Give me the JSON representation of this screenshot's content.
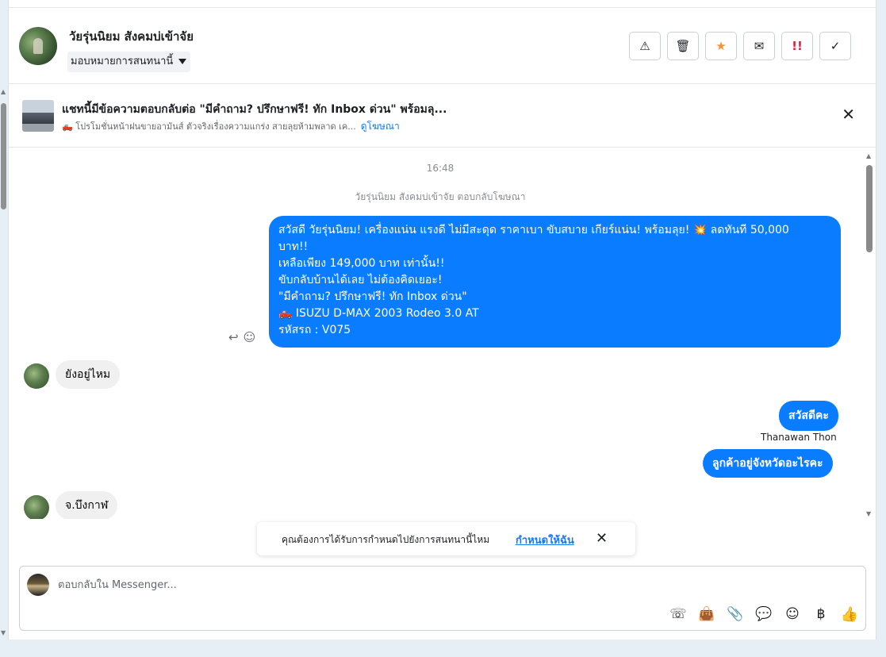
{
  "header": {
    "contact_name": "วัยรุ่นนิยม สังคมบ่เข้าจัย",
    "assign_label": "มอบหมายการสนทนานี้",
    "actions": {
      "spam": "⚠",
      "delete": "🗑",
      "star": "★",
      "mark_unread": "✉",
      "urgent": "!!",
      "done": "✓"
    }
  },
  "ad_banner": {
    "title": "แชทนี้มีข้อความตอบกลับต่อ \"มีคำถาม? ปรึกษาฟรี! ทัก Inbox ด่วน\" พร้อมลุ...",
    "subtitle": "🛻 โปรโมชั่นหน้าฝนขายอามันส์ ตัวจริงเรื่องความแกร่ง สายลุยห้ามพลาด เค...",
    "link": "ดูโฆษณา"
  },
  "chat": {
    "timestamp": "16:48",
    "ad_reply_note": "วัยรุ่นนิยม สังคมบ่เข้าจัย ตอบกลับโฆษณา",
    "ad_message_lines": [
      "สวัสดี วัยรุ่นนิยม! เครื่องแน่น แรงดี ไม่มีสะดุด ราคาเบา ขับสบาย เกียร์แน่น! พร้อมลุย! 💥 ลดทันที 50,000",
      "บาท!!",
      "เหลือเพียง 149,000 บาท เท่านั้น!!",
      "ขับกลับบ้านได้เลย ไม่ต้องคิดเยอะ!",
      "\"มีคำถาม? ปรึกษาฟรี! ทัก Inbox ด่วน\"",
      "🛻 ISUZU D-MAX 2003 Rodeo 3.0 AT",
      "รหัสรถ : V075"
    ],
    "msg_in_1": "ยังอยู่ไหม",
    "msg_out_2": "สวัสดีคะ",
    "sender_name": "Thanawan Thon",
    "msg_out_3": "ลูกค้าอยู่จังหวัดอะไรคะ",
    "msg_in_2": "จ.บึงกาฬ",
    "reply_icon": "↩",
    "react_icon": "☺"
  },
  "toast": {
    "text": "คุณต้องการได้รับการกำหนดไปยังการสนทนานี้ไหม",
    "link": "กำหนดให้ฉัน",
    "close": "✕"
  },
  "composer": {
    "placeholder": "ตอบกลับใน Messenger...",
    "tools": {
      "call": "☏",
      "bag": "👜",
      "attach": "📎",
      "saved_reply": "💬",
      "emoji": "☺",
      "payment": "฿",
      "like": "👍"
    }
  }
}
